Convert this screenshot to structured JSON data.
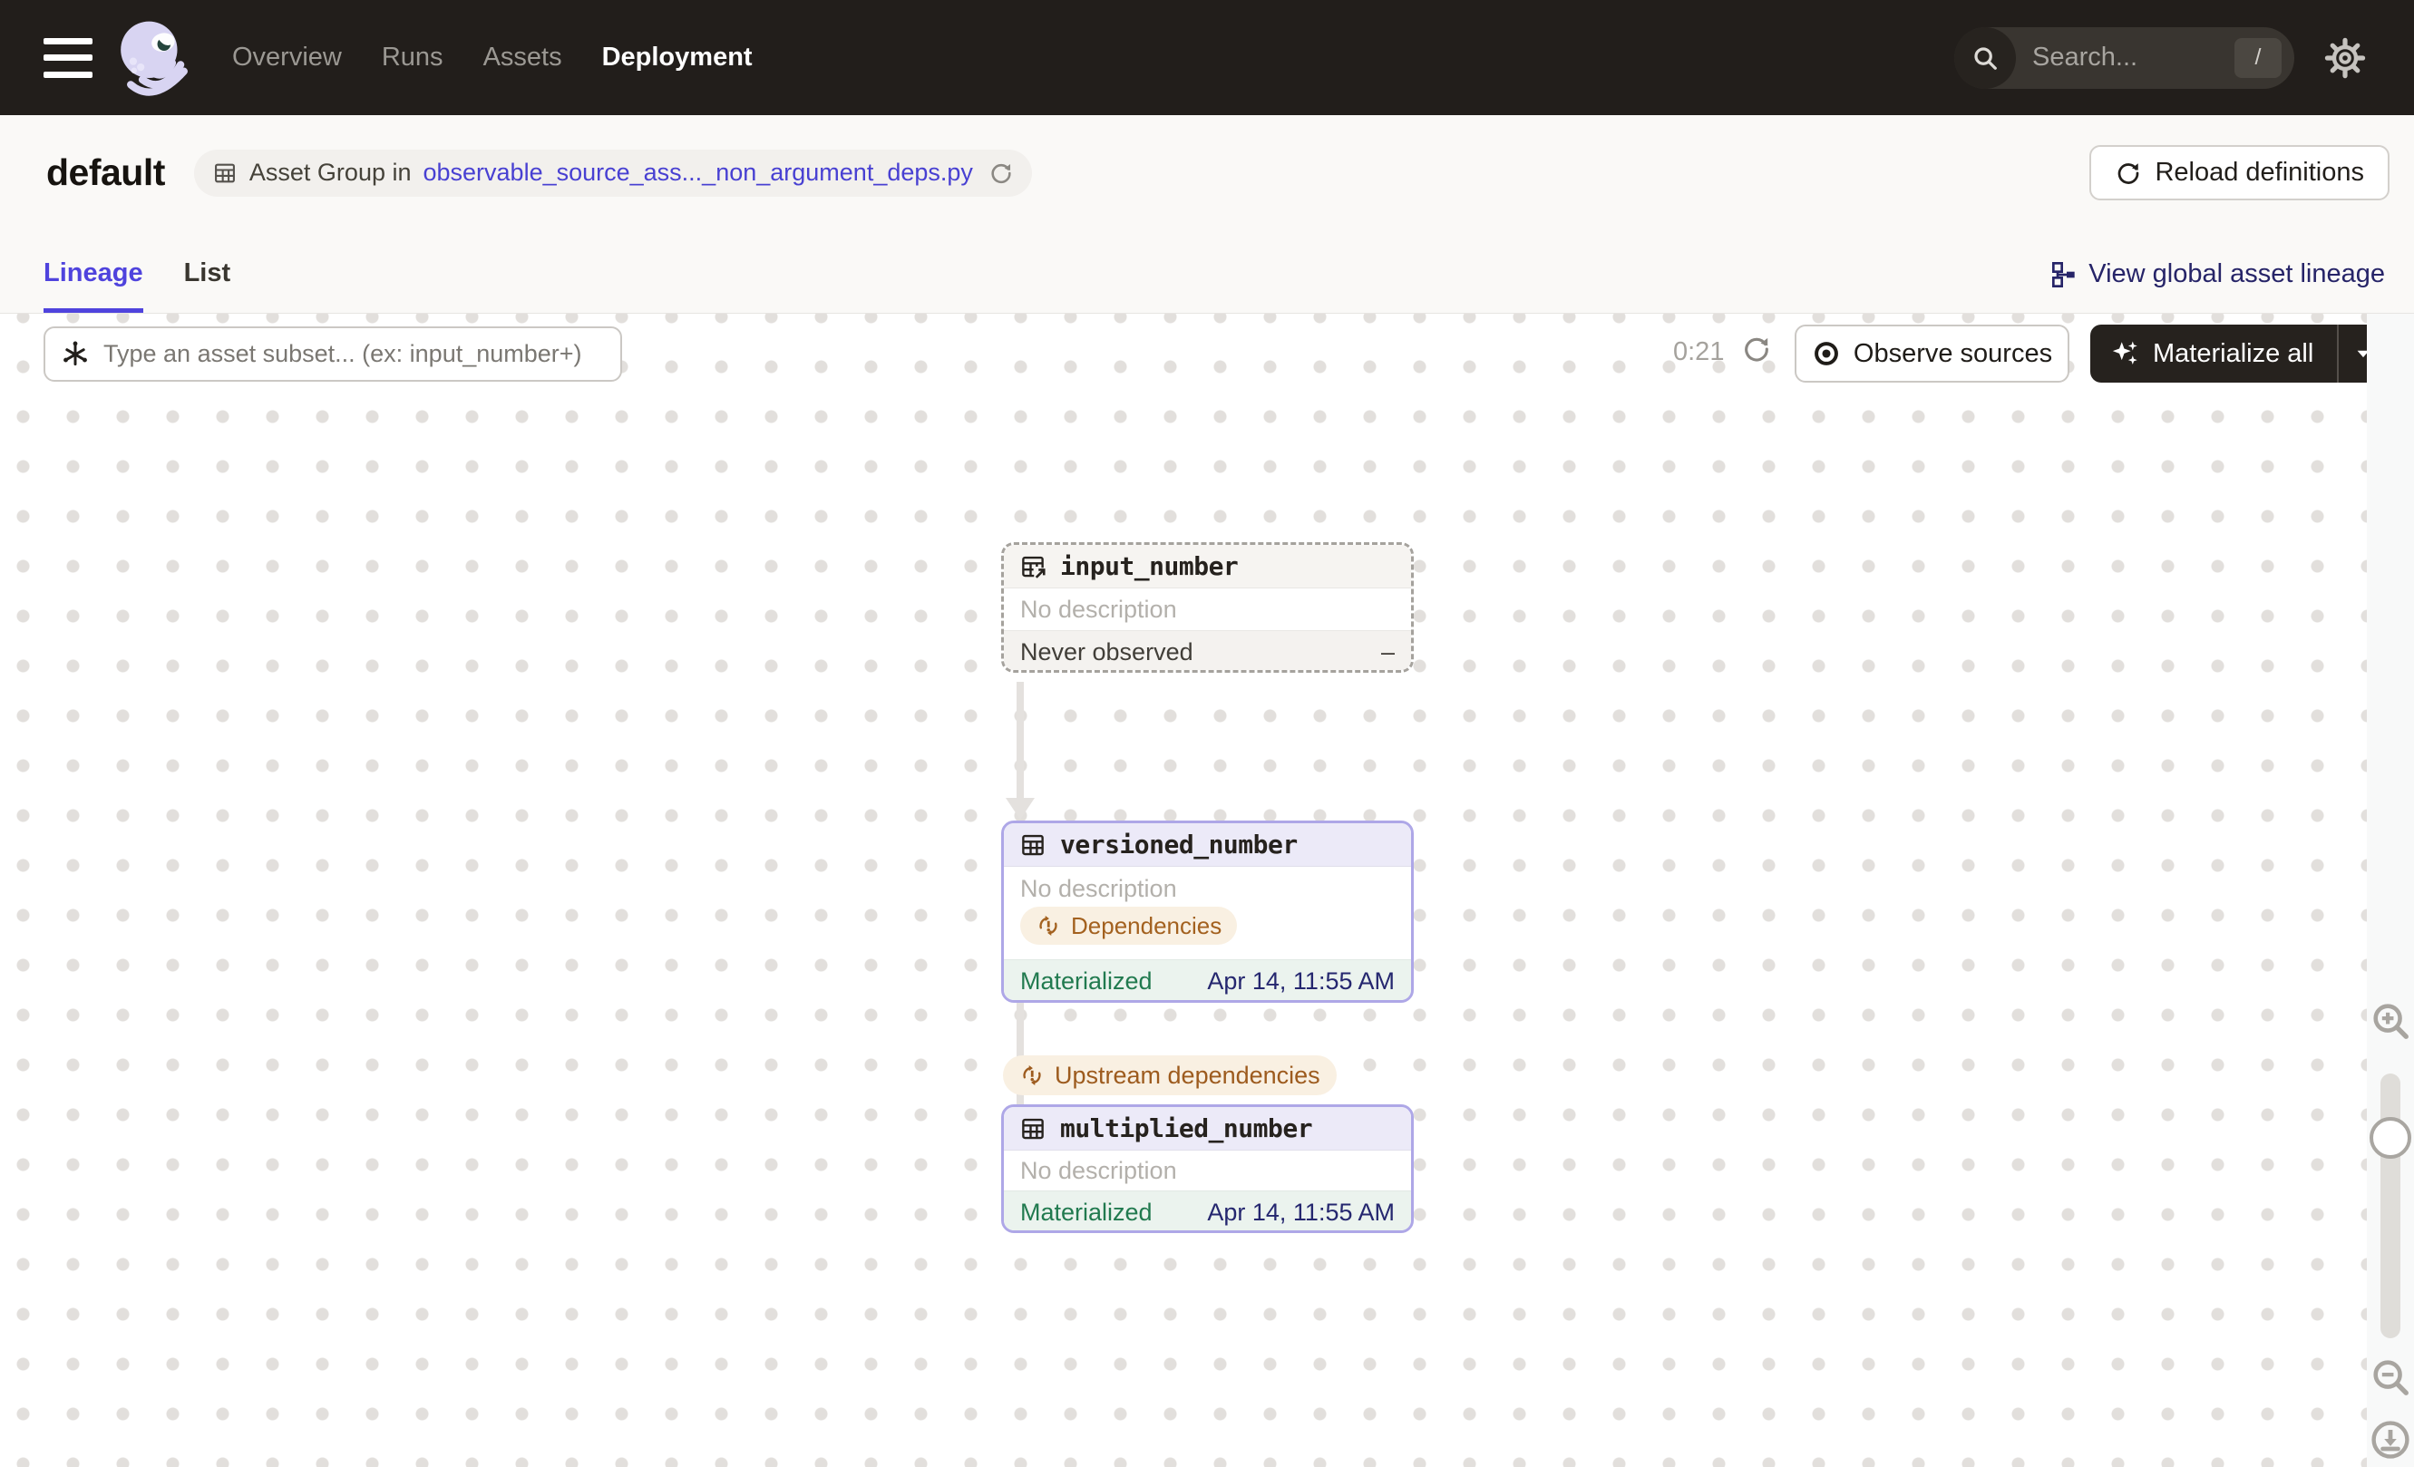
{
  "nav": {
    "items": [
      {
        "label": "Overview",
        "active": false
      },
      {
        "label": "Runs",
        "active": false
      },
      {
        "label": "Assets",
        "active": false
      },
      {
        "label": "Deployment",
        "active": true
      }
    ],
    "search_placeholder": "Search...",
    "search_shortcut": "/"
  },
  "header": {
    "title": "default",
    "breadcrumb_prefix": "Asset Group in",
    "breadcrumb_link": "observable_source_ass..._non_argument_deps.py",
    "reload_button": "Reload definitions"
  },
  "tabs": {
    "lineage": "Lineage",
    "list": "List",
    "active": "Lineage",
    "view_global": "View global asset lineage"
  },
  "toolbar": {
    "filter_placeholder": "Type an asset subset... (ex: input_number+)",
    "timer": "0:21",
    "observe_button": "Observe sources",
    "materialize_button": "Materialize all"
  },
  "graph": {
    "nodes": [
      {
        "name": "input_number",
        "type": "observable-source",
        "description": "No description",
        "status_label": "Never observed",
        "status_value": "–"
      },
      {
        "name": "versioned_number",
        "type": "materialized",
        "description": "No description",
        "badge": "Dependencies",
        "status_label": "Materialized",
        "status_value": "Apr 14, 11:55 AM"
      },
      {
        "name": "multiplied_number",
        "type": "materialized",
        "description": "No description",
        "status_label": "Materialized",
        "status_value": "Apr 14, 11:55 AM"
      }
    ],
    "edge_badge": "Upstream dependencies"
  },
  "colors": {
    "nav_bg": "#221E1B",
    "accent_blurple": "#4F43DD",
    "link_navy": "#262468",
    "materialized_green": "#217A4F",
    "timestamp_navy": "#25276F",
    "warning_brown": "#A3611F",
    "warning_bg": "#F9F0E2",
    "node_border_purple": "#AEA7E7",
    "node_header_purple": "#ECEAF8"
  }
}
